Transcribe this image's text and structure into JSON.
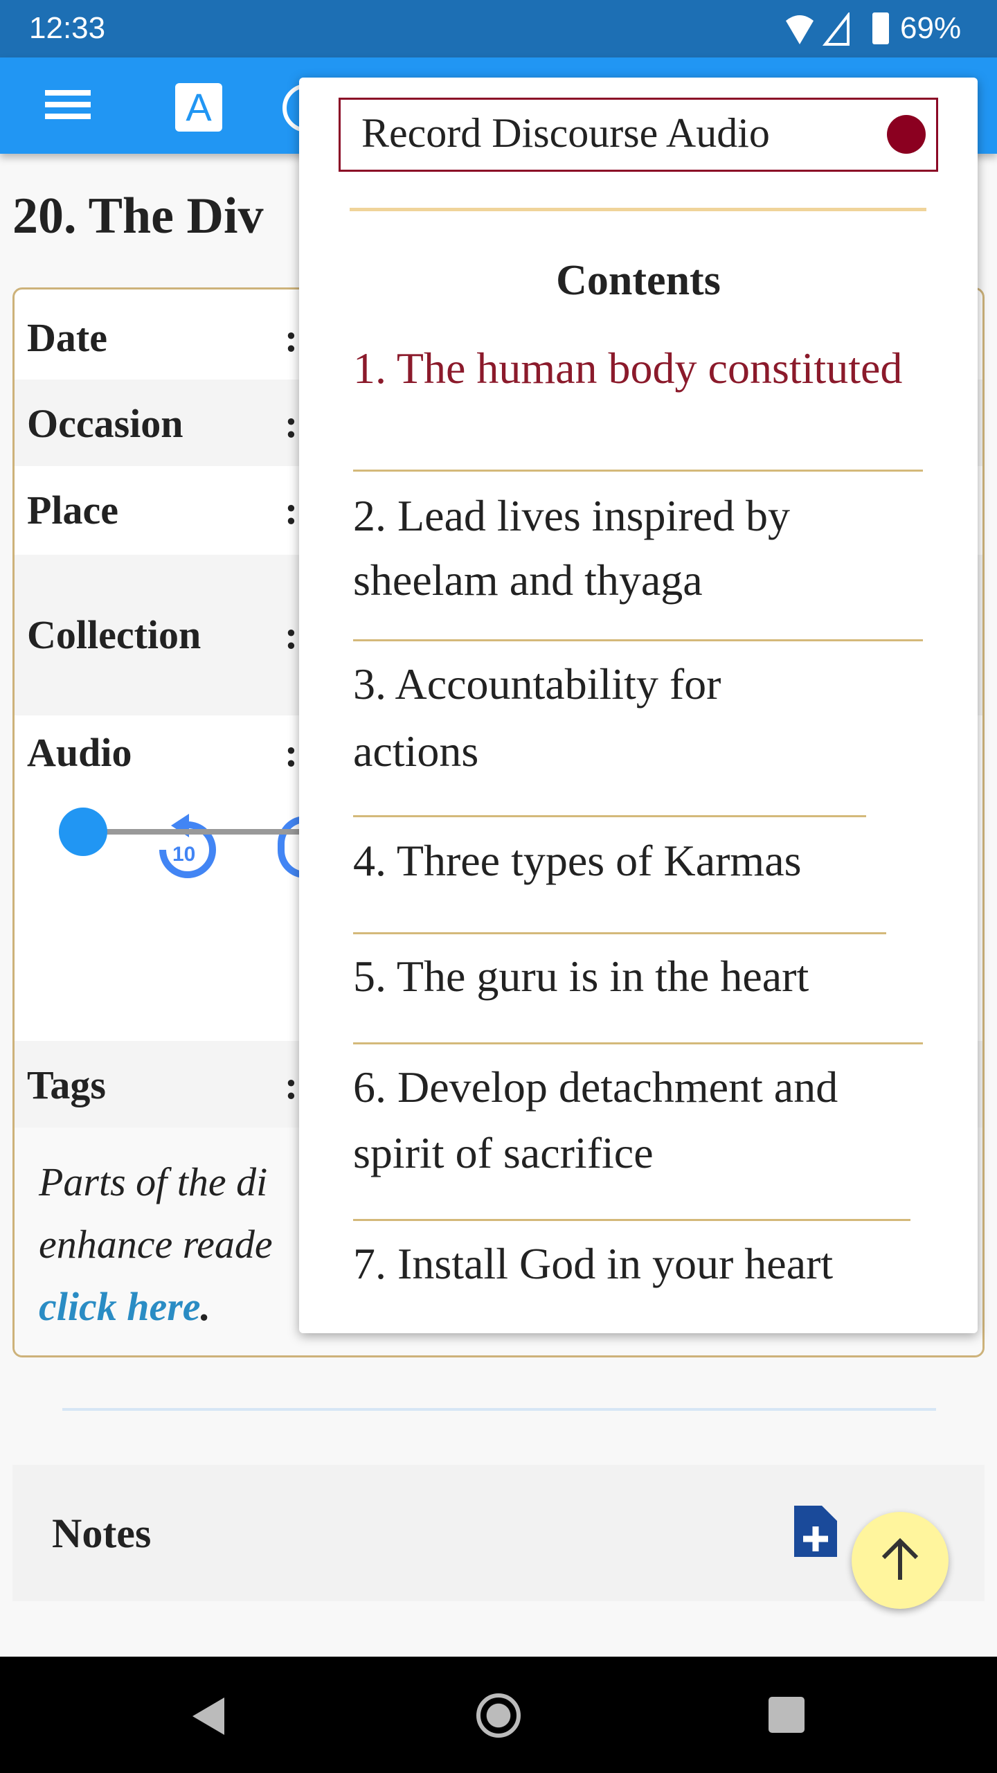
{
  "status": {
    "time": "12:33",
    "battery": "69%"
  },
  "appbar": {
    "font_icon_letter": "A"
  },
  "page": {
    "title": "20. The Div"
  },
  "details": {
    "rows": [
      {
        "label": "Date"
      },
      {
        "label": "Occasion"
      },
      {
        "label": "Place"
      },
      {
        "label": "Collection"
      },
      {
        "label": "Audio"
      },
      {
        "label": "Tags"
      }
    ],
    "colon": ":",
    "replay_label": "10",
    "audio_progress": 0,
    "note_line1": "Parts of the di",
    "note_line2": "enhance reade",
    "link": "click here",
    "link_after": "."
  },
  "popup": {
    "record_label": "Record Discourse Audio",
    "contents_heading": "Contents",
    "items": [
      {
        "lines": [
          "1. The human body constituted"
        ]
      },
      {
        "lines": [
          "2. Lead lives inspired by",
          "sheelam and thyaga"
        ]
      },
      {
        "lines": [
          "3. Accountability for",
          "actions"
        ]
      },
      {
        "lines": [
          "4. Three types of Karmas"
        ]
      },
      {
        "lines": [
          "5. The guru is in the heart"
        ]
      },
      {
        "lines": [
          "6. Develop detachment and",
          "spirit of sacrifice"
        ]
      },
      {
        "lines": [
          "7. Install God in your heart"
        ]
      }
    ]
  },
  "notes": {
    "label": "Notes"
  },
  "colors": {
    "appbar": "#2196f3",
    "status": "#1d6fb4",
    "accent_red": "#8b0020",
    "link": "#2a8cc4",
    "fab": "#fff59d"
  }
}
